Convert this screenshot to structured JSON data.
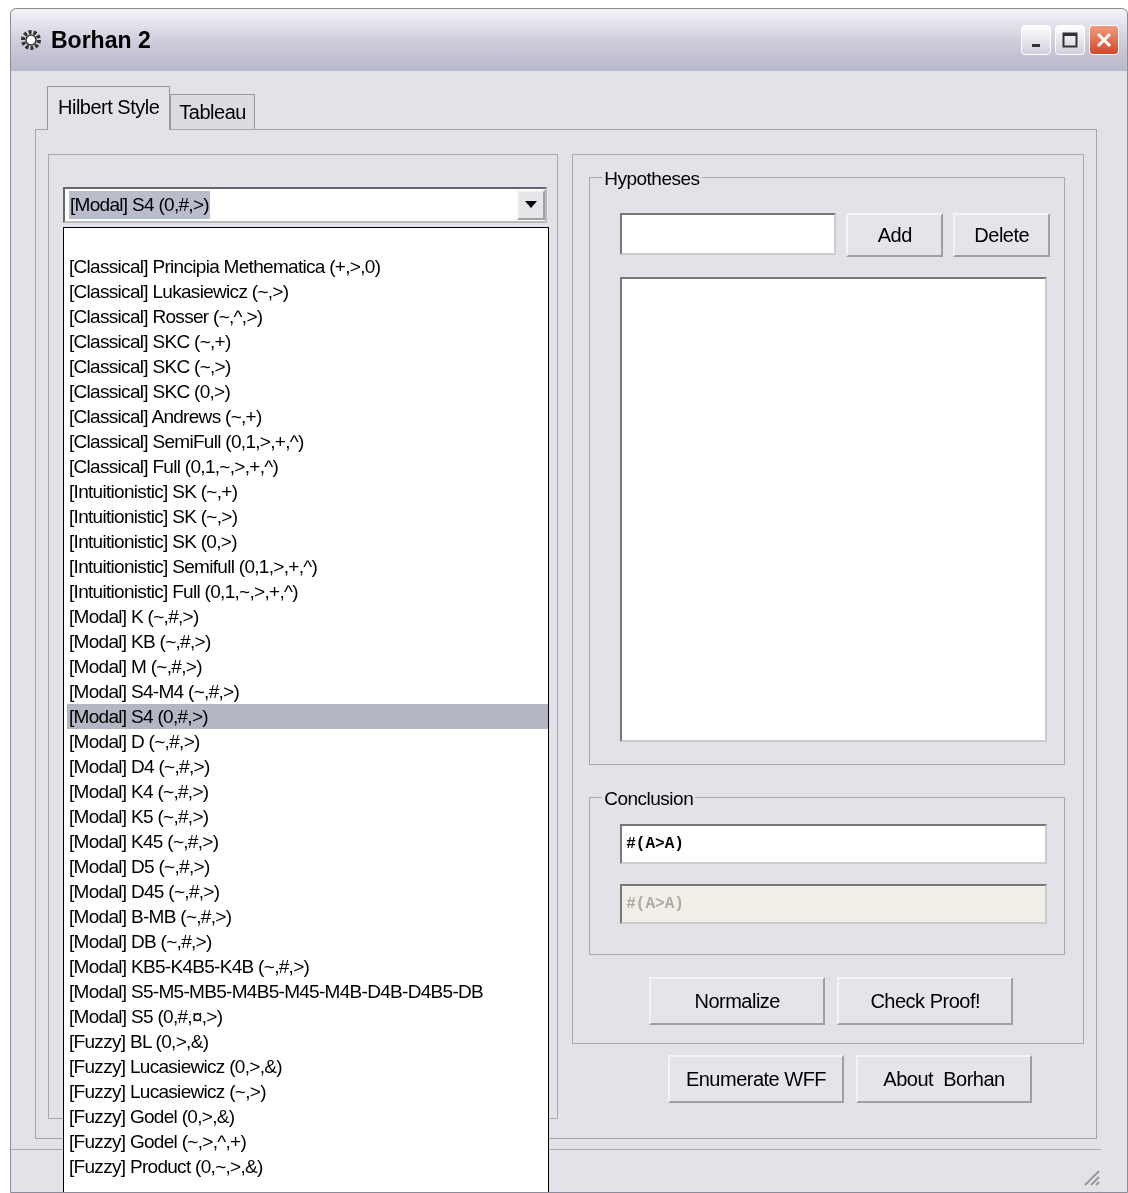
{
  "window": {
    "title": "Borhan 2"
  },
  "tabs": [
    {
      "label": "Hilbert Style",
      "selected": true
    },
    {
      "label": "Tableau",
      "selected": false
    }
  ],
  "logic_select": {
    "value": "[Modal] S4 (0,#,>)",
    "expanded": true
  },
  "logic_list": [
    {
      "label": "[Classical] Principia Methematica (+,>,0)",
      "selected": false
    },
    {
      "label": "[Classical] Lukasiewicz (~,>)",
      "selected": false
    },
    {
      "label": "[Classical] Rosser (~,^,>)",
      "selected": false
    },
    {
      "label": "[Classical] SKC (~,+)",
      "selected": false
    },
    {
      "label": "[Classical] SKC (~,>)",
      "selected": false
    },
    {
      "label": "[Classical] SKC (0,>)",
      "selected": false
    },
    {
      "label": "[Classical] Andrews (~,+)",
      "selected": false
    },
    {
      "label": "[Classical] SemiFull (0,1,>,+,^)",
      "selected": false
    },
    {
      "label": "[Classical] Full (0,1,~,>,+,^)",
      "selected": false
    },
    {
      "label": "[Intuitionistic] SK (~,+)",
      "selected": false
    },
    {
      "label": "[Intuitionistic] SK (~,>)",
      "selected": false
    },
    {
      "label": "[Intuitionistic] SK (0,>)",
      "selected": false
    },
    {
      "label": "[Intuitionistic] Semifull (0,1,>,+,^)",
      "selected": false
    },
    {
      "label": "[Intuitionistic] Full (0,1,~,>,+,^)",
      "selected": false
    },
    {
      "label": "[Modal] K (~,#,>)",
      "selected": false
    },
    {
      "label": "[Modal] KB (~,#,>)",
      "selected": false
    },
    {
      "label": "[Modal] M (~,#,>)",
      "selected": false
    },
    {
      "label": "[Modal] S4-M4 (~,#,>)",
      "selected": false
    },
    {
      "label": "[Modal] S4 (0,#,>)",
      "selected": true
    },
    {
      "label": "[Modal] D (~,#,>)",
      "selected": false
    },
    {
      "label": "[Modal] D4 (~,#,>)",
      "selected": false
    },
    {
      "label": "[Modal] K4 (~,#,>)",
      "selected": false
    },
    {
      "label": "[Modal] K5 (~,#,>)",
      "selected": false
    },
    {
      "label": "[Modal] K45 (~,#,>)",
      "selected": false
    },
    {
      "label": "[Modal] D5 (~,#,>)",
      "selected": false
    },
    {
      "label": "[Modal] D45 (~,#,>)",
      "selected": false
    },
    {
      "label": "[Modal] B-MB (~,#,>)",
      "selected": false
    },
    {
      "label": "[Modal] DB (~,#,>)",
      "selected": false
    },
    {
      "label": "[Modal] KB5-K4B5-K4B (~,#,>)",
      "selected": false
    },
    {
      "label": "[Modal] S5-M5-MB5-M4B5-M45-M4B-D4B-D4B5-DB",
      "selected": false
    },
    {
      "label": "[Modal] S5 (0,#,¤,>)",
      "selected": false
    },
    {
      "label": "[Fuzzy] BL (0,>,&)",
      "selected": false
    },
    {
      "label": "[Fuzzy] Lucasiewicz (0,>,&)",
      "selected": false
    },
    {
      "label": "[Fuzzy] Lucasiewicz (~,>)",
      "selected": false
    },
    {
      "label": "[Fuzzy] Godel (0,>,&)",
      "selected": false
    },
    {
      "label": "[Fuzzy] Godel (~,>,^,+)",
      "selected": false
    },
    {
      "label": "[Fuzzy] Product (0,~,>,&)",
      "selected": false
    }
  ],
  "hypotheses": {
    "title": "Hypotheses",
    "buttons": [
      "Add",
      "Delete"
    ]
  },
  "conclusion": {
    "title": "Conclusion",
    "fields": [
      {
        "value": "#(A>A)",
        "disabled": false
      },
      {
        "value": "#(A>A)",
        "disabled": true
      }
    ]
  },
  "proof_buttons": [
    "Normalize",
    "Check Proof!"
  ],
  "bottom_buttons": [
    "Enumerate WFF",
    "About  Borhan"
  ]
}
